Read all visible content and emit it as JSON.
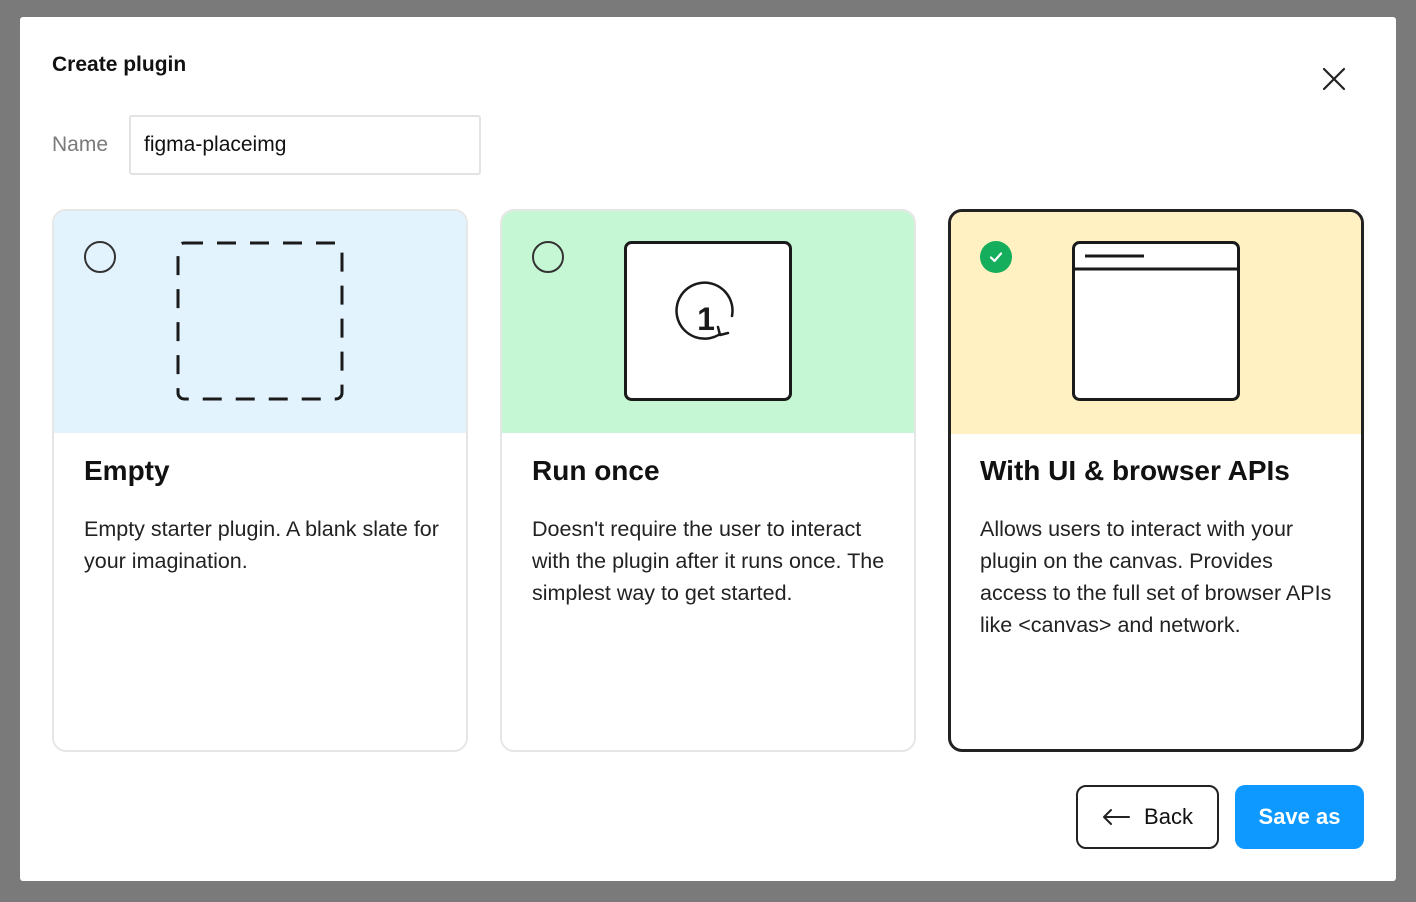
{
  "dialog": {
    "title": "Create plugin",
    "close_icon": "close-icon"
  },
  "name_field": {
    "label": "Name",
    "value": "figma-placeimg"
  },
  "cards": [
    {
      "id": "empty",
      "title": "Empty",
      "description": "Empty starter plugin. A blank slate for your imagination.",
      "selected": false,
      "illustration_color": "#e2f3fe",
      "icon": "dashed-square-icon"
    },
    {
      "id": "run-once",
      "title": "Run once",
      "description": "Doesn't require the user to interact with the plugin after it runs once. The simplest way to get started.",
      "selected": false,
      "illustration_color": "#c6f7d5",
      "icon": "run-once-icon",
      "icon_text": "1"
    },
    {
      "id": "with-ui",
      "title": "With UI & browser APIs",
      "description": "Allows users to interact with your plugin on the canvas. Provides access to the full set of browser APIs like <canvas> and network.",
      "selected": true,
      "illustration_color": "#fff1c1",
      "icon": "browser-window-icon"
    }
  ],
  "footer": {
    "back_label": "Back",
    "back_icon": "arrow-left-icon",
    "save_label": "Save as"
  },
  "colors": {
    "primary": "#0d99ff",
    "selected_check": "#14ae5c",
    "overlay": "#7a7a7a"
  }
}
